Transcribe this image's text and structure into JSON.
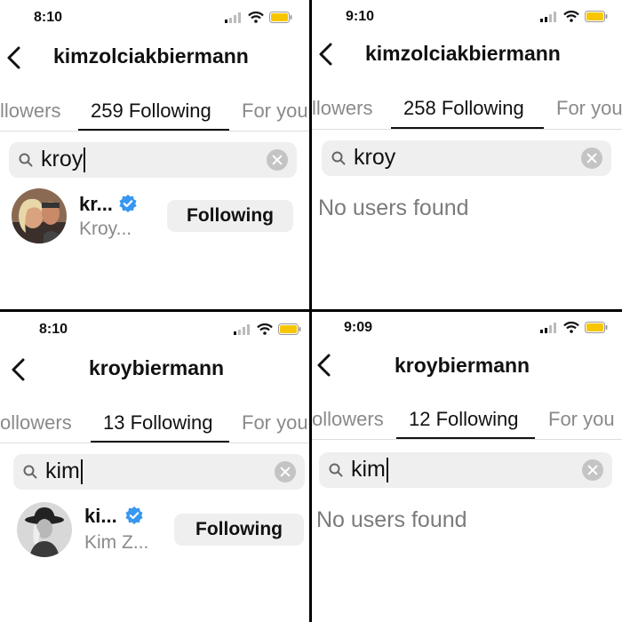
{
  "panels": [
    {
      "time": "8:10",
      "title": "kimzolciakbiermann",
      "tabs": {
        "left": "llowers",
        "active": "259 Following",
        "right": "For you"
      },
      "search_query": "kroy",
      "result": {
        "username": "kr...",
        "fullname": "Kroy...",
        "button": "Following"
      }
    },
    {
      "time": "9:10",
      "title": "kimzolciakbiermann",
      "tabs": {
        "left": "llowers",
        "active": "258 Following",
        "right": "For you"
      },
      "search_query": "kroy",
      "empty_message": "No users found"
    },
    {
      "time": "8:10",
      "title": "kroybiermann",
      "tabs": {
        "left": "ollowers",
        "active": "13 Following",
        "right": "For you"
      },
      "search_query": "kim",
      "result": {
        "username": "ki...",
        "fullname": "Kim Z...",
        "button": "Following"
      }
    },
    {
      "time": "9:09",
      "title": "kroybiermann",
      "tabs": {
        "left": "ollowers",
        "active": "12 Following",
        "right": "For you"
      },
      "search_query": "kim",
      "empty_message": "No users found"
    }
  ],
  "colors": {
    "verified": "#3897f0",
    "battery": "#f7c600",
    "muted_text": "#8a8a8a",
    "search_bg": "#efefef"
  },
  "icons": [
    "signal-icon",
    "wifi-icon",
    "battery-icon",
    "back-chevron-icon",
    "search-icon",
    "clear-icon",
    "verified-badge-icon"
  ]
}
